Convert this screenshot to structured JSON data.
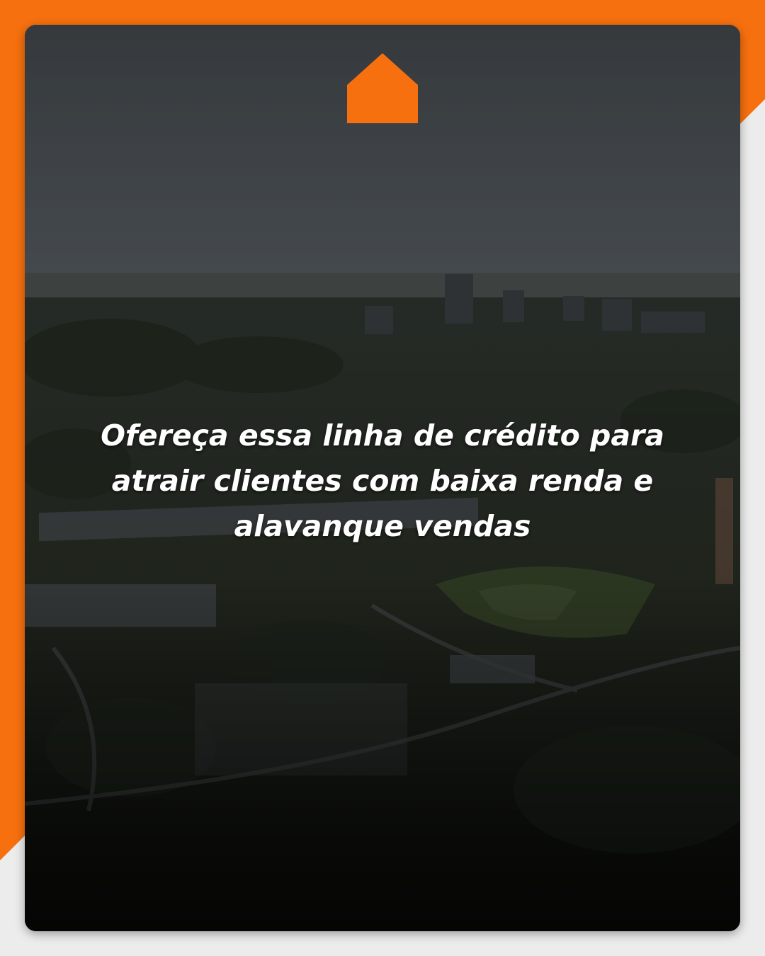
{
  "headline": "Ofereça essa linha de crédito para atrair clientes com baixa renda e alavanque vendas",
  "logo": {
    "icon": "house-icon",
    "color": "#f7700f"
  },
  "colors": {
    "accent": "#f7700f",
    "background": "#ececec",
    "text": "#ffffff"
  }
}
